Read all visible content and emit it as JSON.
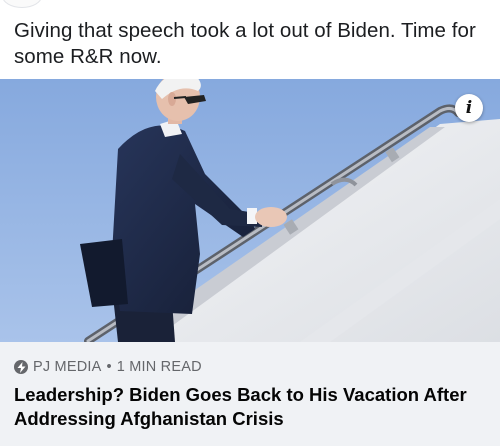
{
  "post": {
    "text": "Giving that speech took a lot out of Biden. Time for some R&R now."
  },
  "link_card": {
    "source": "PJ MEDIA",
    "separator": "•",
    "read_time": "1 MIN READ",
    "headline": "Leadership? Biden Goes Back to His Vacation After Addressing Afghanistan Crisis",
    "info_icon_label": "i",
    "icon": "lightning-bolt-icon"
  },
  "colors": {
    "sky": "#8fb2e2",
    "stair_white": "#eef0f3",
    "suit_navy": "#1f2a44",
    "footer_bg": "#f0f2f5",
    "meta_text": "#65676b"
  }
}
